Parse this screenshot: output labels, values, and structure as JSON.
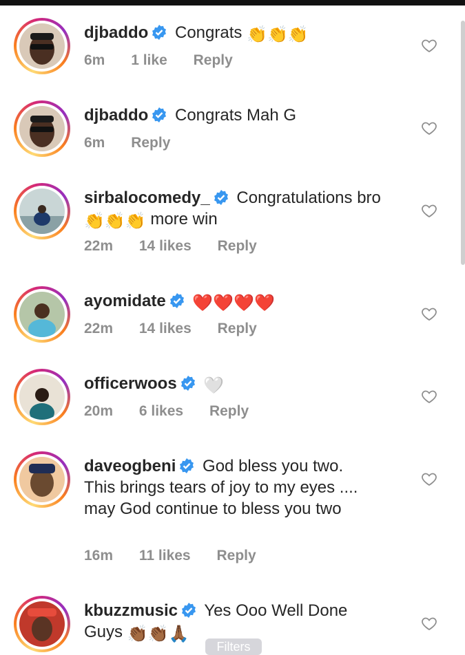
{
  "comments": [
    {
      "username": "djbaddo",
      "text": "Congrats",
      "emojis": [
        "👏",
        "👏",
        "👏"
      ],
      "time": "6m",
      "likes": "1 like",
      "reply": "Reply"
    },
    {
      "username": "djbaddo",
      "text": "Congrats Mah G",
      "emojis": [],
      "time": "6m",
      "likes": "",
      "reply": "Reply"
    },
    {
      "username": "sirbalocomedy_",
      "text": "Congratulations bro",
      "text2": "more win",
      "emojis": [
        "👏",
        "👏",
        "👏"
      ],
      "time": "22m",
      "likes": "14 likes",
      "reply": "Reply"
    },
    {
      "username": "ayomidate",
      "text": "",
      "emojis": [
        "❤️",
        "❤️",
        "❤️",
        "❤️"
      ],
      "time": "22m",
      "likes": "14 likes",
      "reply": "Reply"
    },
    {
      "username": "officerwoos",
      "text": "",
      "emojis": [
        "🤍"
      ],
      "time": "20m",
      "likes": "6 likes",
      "reply": "Reply"
    },
    {
      "username": "daveogbeni",
      "text": "God bless you two.",
      "text2": "This brings tears of joy to my eyes ....",
      "text3": "may God continue to bless you two",
      "emojis": [],
      "time": "16m",
      "likes": "11 likes",
      "reply": "Reply"
    },
    {
      "username": "kbuzzmusic",
      "text": "Yes Ooo Well Done",
      "text2": "Guys",
      "emojis": [
        "👏🏾",
        "👏🏾",
        "🙏🏾"
      ],
      "time": "",
      "likes": "",
      "reply": ""
    }
  ],
  "icons": {
    "verified": "verified-badge-icon",
    "heart": "heart-outline-icon"
  },
  "colors": {
    "verified_blue": "#3897f0",
    "meta_gray": "#8e8e8e",
    "text": "#262626"
  },
  "overlay": {
    "filters_label": "Filters"
  }
}
